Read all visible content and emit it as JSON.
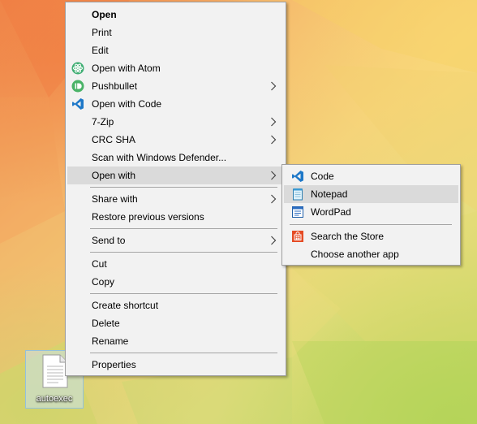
{
  "desktop": {
    "file_name": "autoexec"
  },
  "context_menu": {
    "open": "Open",
    "print": "Print",
    "edit": "Edit",
    "open_with_atom": "Open with Atom",
    "pushbullet": "Pushbullet",
    "open_with_code": "Open with Code",
    "seven_zip": "7-Zip",
    "crc_sha": "CRC SHA",
    "scan_defender": "Scan with Windows Defender...",
    "open_with": "Open with",
    "share_with": "Share with",
    "restore_previous": "Restore previous versions",
    "send_to": "Send to",
    "cut": "Cut",
    "copy": "Copy",
    "create_shortcut": "Create shortcut",
    "delete": "Delete",
    "rename": "Rename",
    "properties": "Properties"
  },
  "open_with_submenu": {
    "code": "Code",
    "notepad": "Notepad",
    "wordpad": "WordPad",
    "search_store": "Search the Store",
    "choose_another": "Choose another app"
  },
  "icons": {
    "atom": "atom-icon",
    "pushbullet": "pushbullet-icon",
    "vscode": "vscode-icon",
    "notepad": "notepad-icon",
    "wordpad": "wordpad-icon",
    "store": "store-icon",
    "chevron": "chevron-right-icon"
  },
  "colors": {
    "menu_bg": "#f2f2f2",
    "menu_highlight": "#dadada",
    "vscode_blue": "#1e78c8",
    "atom_green": "#3fae73",
    "pushbullet_green": "#4ab367",
    "store_red": "#e54b24"
  }
}
